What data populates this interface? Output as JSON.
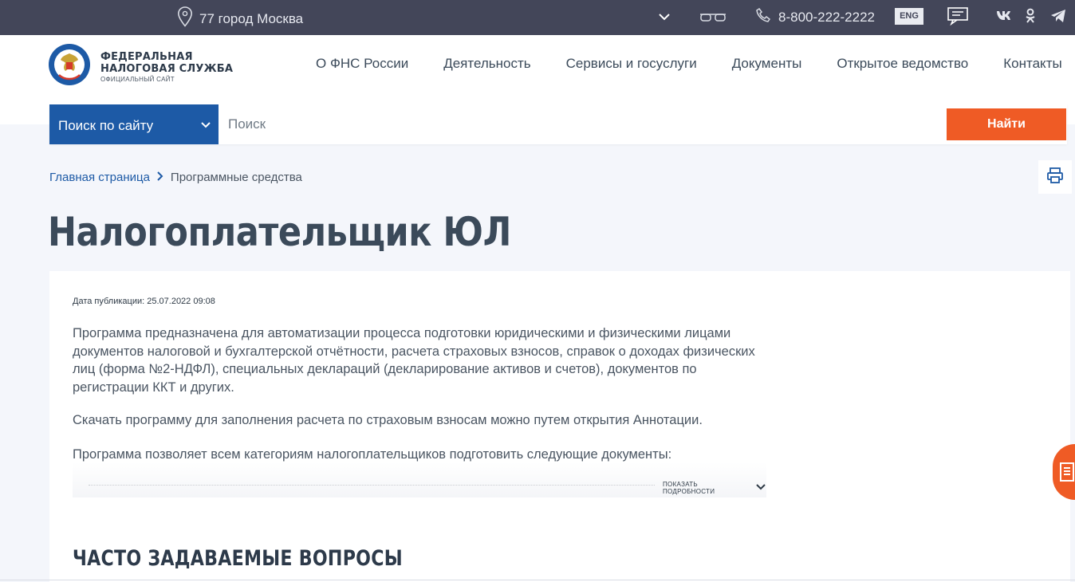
{
  "topbar": {
    "location": "77 город Москва",
    "phone": "8-800-222-2222",
    "lang": "ENG",
    "icons": [
      "location-icon",
      "chevron-down-icon",
      "glasses-icon",
      "phone-icon",
      "chat-icon",
      "vk-icon",
      "odnoklassniki-icon",
      "telegram-icon"
    ]
  },
  "header": {
    "org_line1": "ФЕДЕРАЛЬНАЯ",
    "org_line2": "НАЛОГОВАЯ СЛУЖБА",
    "org_sub": "ОФИЦИАЛЬНЫЙ САЙТ",
    "nav": [
      "О ФНС России",
      "Деятельность",
      "Сервисы и госуслуги",
      "Документы",
      "Открытое ведомство",
      "Контакты"
    ]
  },
  "search": {
    "scope": "Поиск по сайту",
    "placeholder": "Поиск",
    "button": "Найти"
  },
  "breadcrumb": {
    "home": "Главная страница",
    "current": "Программные средства"
  },
  "page": {
    "title": "Налогоплательщик ЮЛ",
    "pub_date": "Дата публикации: 25.07.2022 09:08",
    "para1": "Программа предназначена для автоматизации процесса подготовки юридическими и физическими лицами документов налоговой и бухгалтерской отчётности, расчета страховых взносов, справок о доходах физических лиц (форма №2-НДФЛ), специальных деклараций (декларирование активов и счетов), документов по регистрации ККТ и других.",
    "para2": "Скачать программу для заполнения расчета по страховым взносам можно путем открытия Аннотации.",
    "para3": "Программа позволяет всем категориям налогоплательщиков подготовить следующие документы:",
    "show_more": "показать подробности",
    "faq_heading": "ЧАСТО ЗАДАВАЕМЫЕ ВОПРОСЫ"
  },
  "colors": {
    "topbar": "#434659",
    "brand_blue": "#1d5aa6",
    "accent_orange": "#ef5b25",
    "page_bg": "#f4f6fb"
  }
}
